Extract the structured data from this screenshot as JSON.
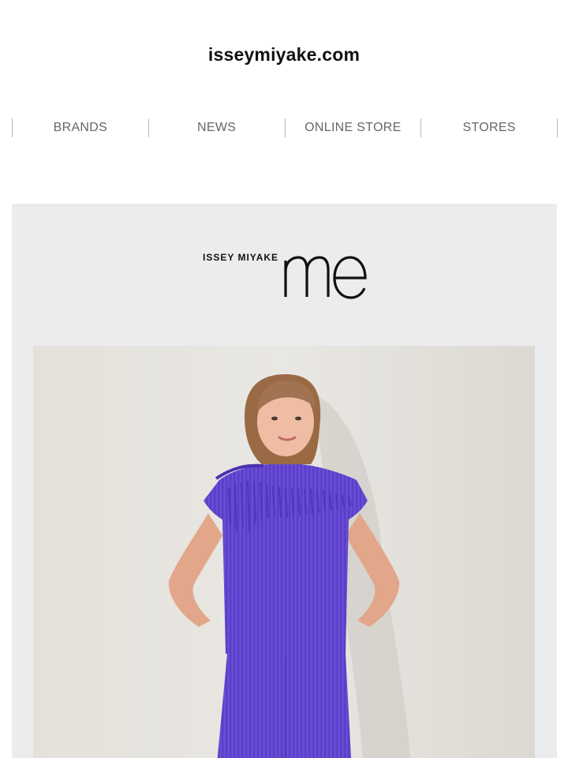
{
  "header": {
    "site_title": "isseymiyake.com"
  },
  "nav": {
    "items": [
      {
        "label": "BRANDS"
      },
      {
        "label": "NEWS"
      },
      {
        "label": "ONLINE STORE"
      },
      {
        "label": "STORES"
      }
    ]
  },
  "brand": {
    "logo_wordmark": "ISSEY MIYAKE",
    "logo_mark": "me",
    "panel_color": "#ebecee"
  },
  "hero": {
    "subject_garment_color": "#6a4bd6"
  },
  "icons": [
    "me-logo-icon"
  ]
}
